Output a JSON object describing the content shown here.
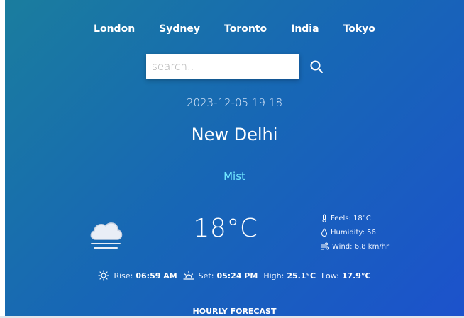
{
  "cities": [
    "London",
    "Sydney",
    "Toronto",
    "India",
    "Tokyo"
  ],
  "search": {
    "placeholder": "search..",
    "value": ""
  },
  "weather": {
    "datetime": "2023-12-05 19:18",
    "location": "New Delhi",
    "condition": "Mist",
    "temperature": "18°C",
    "icon": "cloud-fog-icon",
    "feels_label": "Feels:",
    "feels_value": "18°C",
    "humidity_label": "Humidity:",
    "humidity_value": "56",
    "wind_label": "Wind:",
    "wind_value": "6.8 km/hr",
    "rise_label": "Rise:",
    "rise_value": "06:59 AM",
    "set_label": "Set:",
    "set_value": "05:24 PM",
    "high_label": "High:",
    "high_value": "25.1°C",
    "low_label": "Low:",
    "low_value": "17.9°C"
  },
  "hourly_title": "HOURLY FORECAST",
  "colors": {
    "gradient_start": "#1a7d9e",
    "gradient_end": "#1c52cc",
    "condition": "#6fe6ff"
  }
}
